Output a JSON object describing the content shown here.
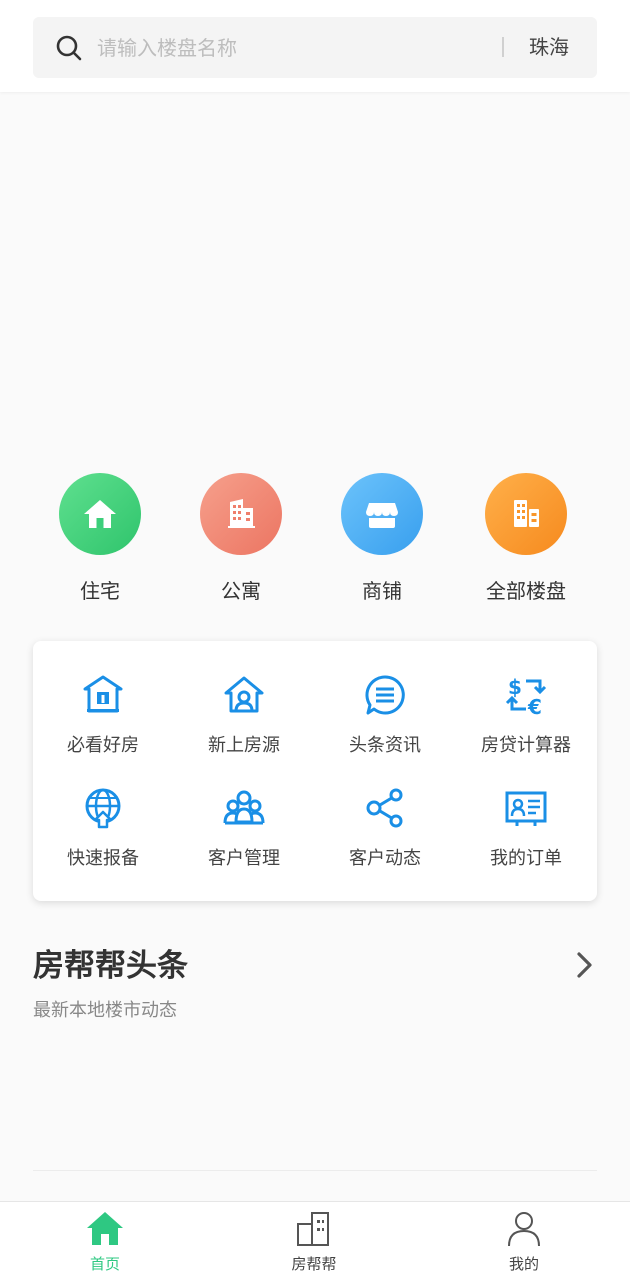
{
  "search": {
    "placeholder": "请输入楼盘名称",
    "city": "珠海"
  },
  "categories": [
    {
      "label": "住宅",
      "icon": "house-icon",
      "color": "#3ccf7a"
    },
    {
      "label": "公寓",
      "icon": "apartment-icon",
      "color": "#f0826e"
    },
    {
      "label": "商铺",
      "icon": "shop-icon",
      "color": "#45aef2"
    },
    {
      "label": "全部楼盘",
      "icon": "buildings-icon",
      "color": "#fa9a2c"
    }
  ],
  "tools": [
    {
      "label": "必看好房",
      "icon": "recommended-house-icon"
    },
    {
      "label": "新上房源",
      "icon": "new-listing-icon"
    },
    {
      "label": "头条资讯",
      "icon": "news-bubble-icon"
    },
    {
      "label": "房贷计算器",
      "icon": "currency-exchange-icon"
    },
    {
      "label": "快速报备",
      "icon": "globe-upload-icon"
    },
    {
      "label": "客户管理",
      "icon": "group-icon"
    },
    {
      "label": "客户动态",
      "icon": "share-icon"
    },
    {
      "label": "我的订单",
      "icon": "id-card-icon"
    }
  ],
  "news": {
    "title": "房帮帮头条",
    "subtitle": "最新本地楼市动态"
  },
  "tabs": [
    {
      "label": "首页",
      "icon": "home-icon",
      "active": true
    },
    {
      "label": "房帮帮",
      "icon": "building-icon",
      "active": false
    },
    {
      "label": "我的",
      "icon": "person-icon",
      "active": false
    }
  ],
  "colors": {
    "accent": "#2ec882",
    "toolIcon": "#1a8fe6"
  }
}
